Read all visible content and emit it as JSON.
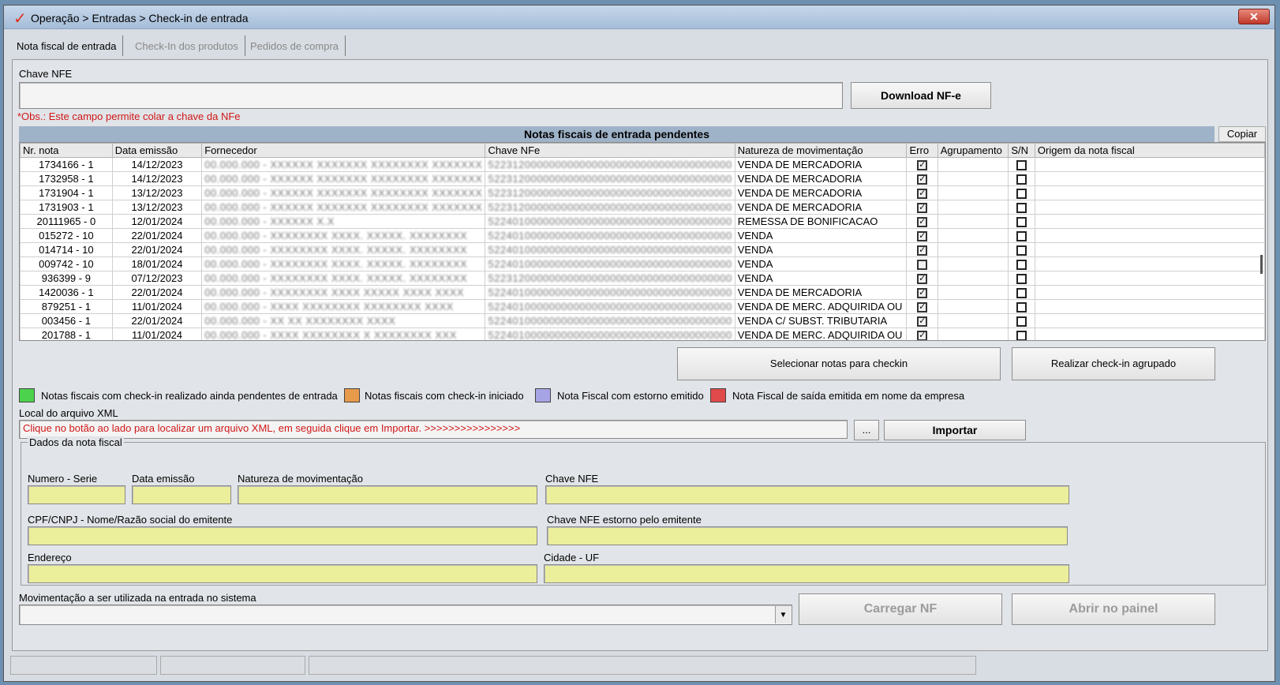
{
  "window": {
    "title": "Operação > Entradas > Check-in de entrada",
    "close_label": "✕"
  },
  "tabs": [
    "Nota fiscal de entrada",
    "Check-In dos produtos",
    "Pedidos de compra"
  ],
  "chave": {
    "label": "Chave NFE",
    "value": "",
    "download_label": "Download NF-e",
    "note": "*Obs.: Este campo permite colar a chave da NFe"
  },
  "grid": {
    "title": "Notas fiscais de entrada pendentes",
    "copy_label": "Copiar",
    "columns": [
      "Nr. nota",
      "Data emissão",
      "Fornecedor",
      "Chave NFe",
      "Natureza de movimentação",
      "Erro",
      "Agrupamento",
      "S/N",
      "Origem da nota fiscal"
    ],
    "rows": [
      {
        "nr": "1734166 - 1",
        "data": "14/12/2023",
        "fornecedor": "00.000.000 - XXXXXX XXXXXXX XXXXXXXX XXXXXXX",
        "chave": "5223120000000000000000000000000000000000",
        "natureza": "VENDA DE MERCADORIA",
        "erro": true
      },
      {
        "nr": "1732958 - 1",
        "data": "14/12/2023",
        "fornecedor": "00.000.000 - XXXXXX XXXXXXX XXXXXXXX XXXXXXX",
        "chave": "5223120000000000000000000000000000000000",
        "natureza": "VENDA DE MERCADORIA",
        "erro": true
      },
      {
        "nr": "1731904 - 1",
        "data": "13/12/2023",
        "fornecedor": "00.000.000 - XXXXXX XXXXXXX XXXXXXXX XXXXXXX",
        "chave": "5223120000000000000000000000000000000000",
        "natureza": "VENDA DE MERCADORIA",
        "erro": true
      },
      {
        "nr": "1731903 - 1",
        "data": "13/12/2023",
        "fornecedor": "00.000.000 - XXXXXX XXXXXXX XXXXXXXX XXXXXXX",
        "chave": "5223120000000000000000000000000000000000",
        "natureza": "VENDA DE MERCADORIA",
        "erro": true
      },
      {
        "nr": "20111965 - 0",
        "data": "12/01/2024",
        "fornecedor": "00.000.000 - XXXXXX X.X",
        "chave": "5224010000000000000000000000000000000000",
        "natureza": "REMESSA DE BONIFICACAO",
        "erro": true
      },
      {
        "nr": "015272 - 10",
        "data": "22/01/2024",
        "fornecedor": "00.000.000 - XXXXXXXX XXXX. XXXXX. XXXXXXXX",
        "chave": "5224010000000000000000000000000000000000",
        "natureza": "VENDA",
        "erro": true
      },
      {
        "nr": "014714 - 10",
        "data": "22/01/2024",
        "fornecedor": "00.000.000 - XXXXXXXX XXXX. XXXXX. XXXXXXXX",
        "chave": "5224010000000000000000000000000000000000",
        "natureza": "VENDA",
        "erro": true
      },
      {
        "nr": "009742 - 10",
        "data": "18/01/2024",
        "fornecedor": "00.000.000 - XXXXXXXX XXXX. XXXXX. XXXXXXXX",
        "chave": "5224010000000000000000000000000000000000",
        "natureza": "VENDA",
        "erro": false
      },
      {
        "nr": "936399 - 9",
        "data": "07/12/2023",
        "fornecedor": "00.000.000 - XXXXXXXX XXXX. XXXXX. XXXXXXXX",
        "chave": "5223120000000000000000000000000000000000",
        "natureza": "VENDA",
        "erro": true
      },
      {
        "nr": "1420036 - 1",
        "data": "22/01/2024",
        "fornecedor": "00.000.000 - XXXXXXXX XXXX XXXXX XXXX XXXX",
        "chave": "5224010000000000000000000000000000000000",
        "natureza": "VENDA DE MERCADORIA",
        "erro": true
      },
      {
        "nr": "879251 - 1",
        "data": "11/01/2024",
        "fornecedor": "00.000.000 - XXXX XXXXXXXX XXXXXXXX XXXX",
        "chave": "5224010000000000000000000000000000000000",
        "natureza": "VENDA DE MERC. ADQUIRIDA OU",
        "erro": true
      },
      {
        "nr": "003456 - 1",
        "data": "22/01/2024",
        "fornecedor": "00.000.000 - XX XX XXXXXXXX XXXX",
        "chave": "5224010000000000000000000000000000000000",
        "natureza": "VENDA C/ SUBST. TRIBUTARIA",
        "erro": true
      },
      {
        "nr": "201788 - 1",
        "data": "11/01/2024",
        "fornecedor": "00.000.000 - XXXX XXXXXXXX X XXXXXXXX XXX",
        "chave": "5224010000000000000000000000000000000000",
        "natureza": "VENDA DE MERC. ADQUIRIDA OU",
        "erro": true
      }
    ]
  },
  "actions": {
    "select_label": "Selecionar notas para checkin",
    "grouped_label": "Realizar check-in agrupado"
  },
  "legend": [
    {
      "label": "Notas fiscais com check-in realizado ainda pendentes de entrada",
      "color": "#4cd24c"
    },
    {
      "label": "Notas fiscais com check-in iniciado",
      "color": "#e69a4a"
    },
    {
      "label": "Nota Fiscal com estorno emitido",
      "color": "#a7a4e6"
    },
    {
      "label": "Nota Fiscal de saída emitida em nome da empresa",
      "color": "#e04a4a"
    }
  ],
  "xml": {
    "label": "Local do arquivo XML",
    "hint": "Clique no botão ao lado para localizar um arquivo XML, em seguida clique em Importar.  >>>>>>>>>>>>>>>>",
    "browse_label": "...",
    "import_label": "Importar"
  },
  "dados": {
    "legend": "Dados da nota fiscal",
    "numero_serie": "Numero - Serie",
    "data_emissao": "Data emissão",
    "natureza": "Natureza de movimentação",
    "chave_nfe": "Chave NFE",
    "cpf_cnpj": "CPF/CNPJ - Nome/Razão social do emitente",
    "chave_estorno": "Chave NFE estorno pelo emitente",
    "endereco": "Endereço",
    "cidade_uf": "Cidade - UF"
  },
  "movimentacao": {
    "label": "Movimentação a ser utilizada na entrada no sistema",
    "value": "",
    "carregar_label": "Carregar NF",
    "abrir_label": "Abrir no painel"
  }
}
